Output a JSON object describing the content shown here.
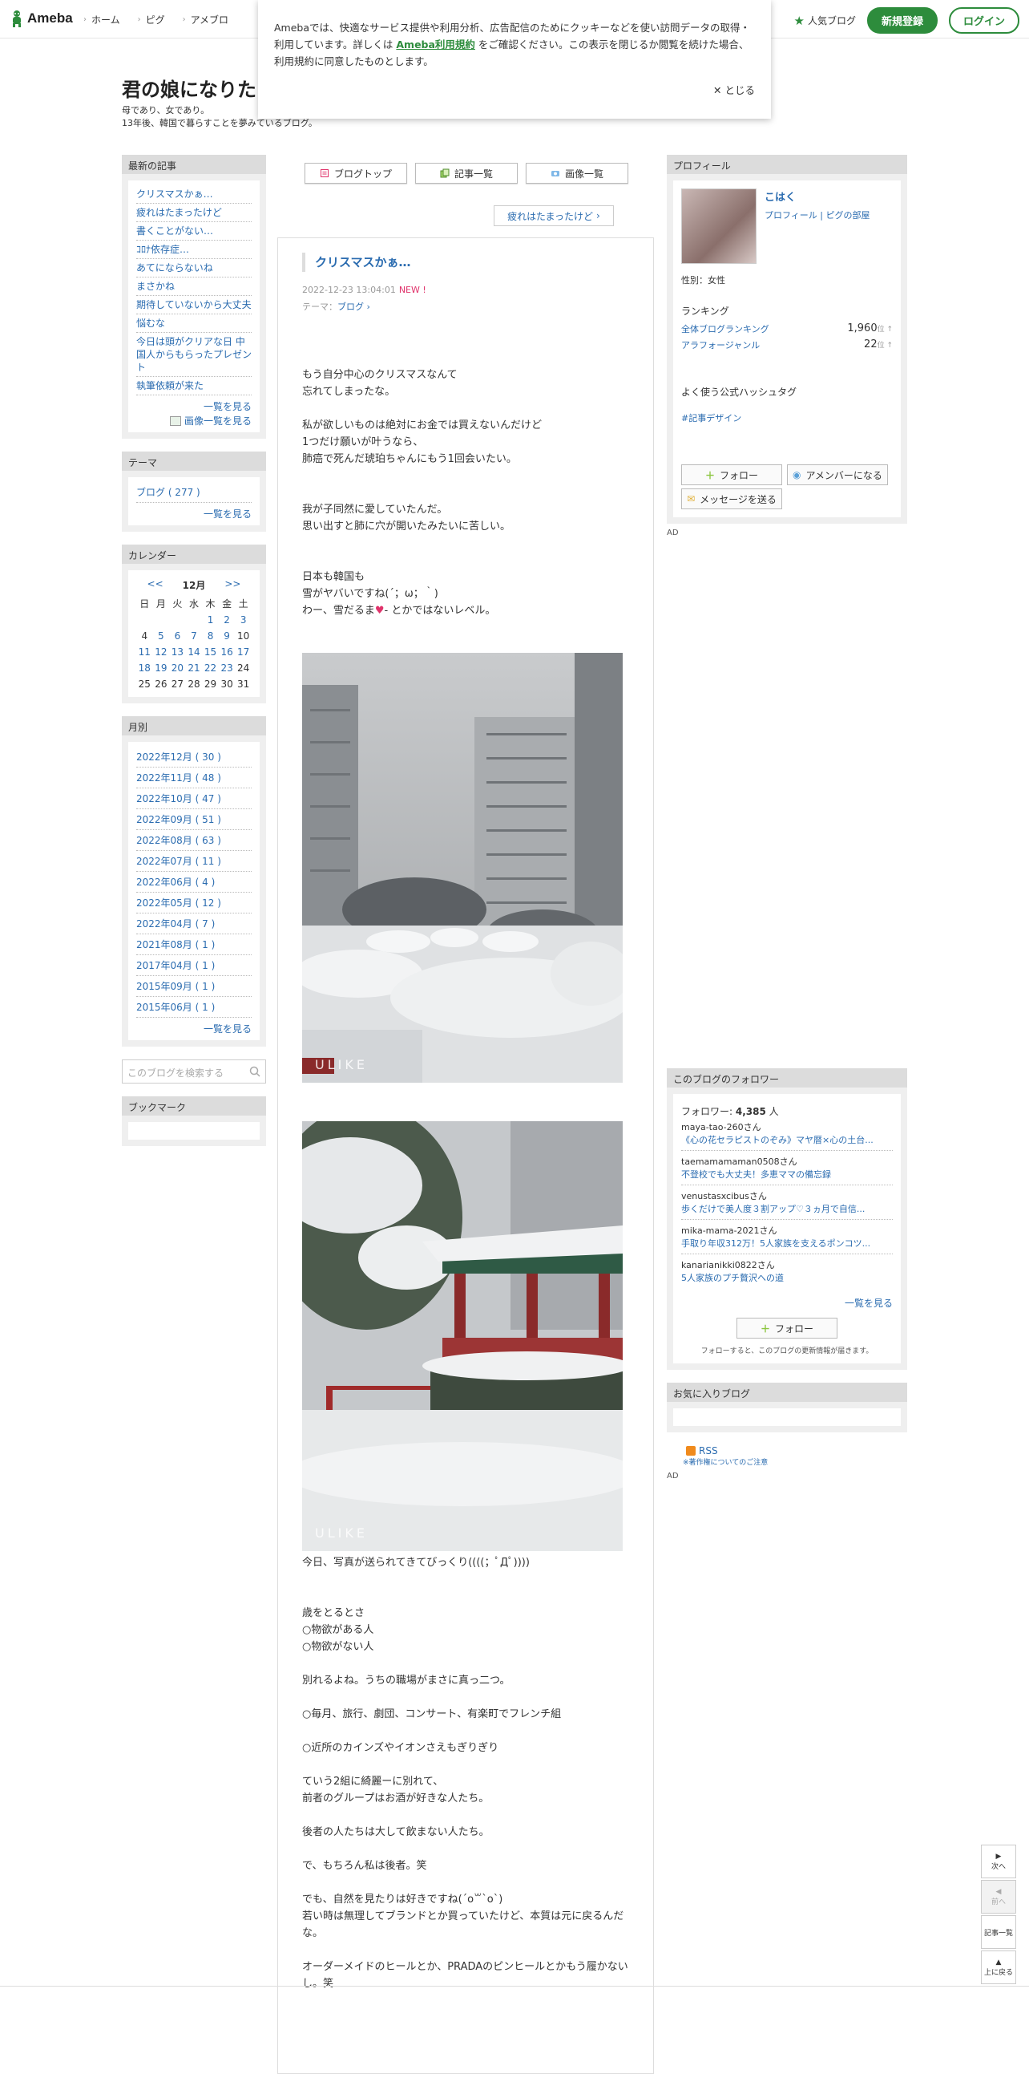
{
  "header": {
    "logo_text": "Ameba",
    "nav": [
      "ホーム",
      "ピグ",
      "アメブロ"
    ],
    "popular_blog": "人気ブログ",
    "register": "新規登録",
    "login": "ログイン",
    "accent_color": "#2d8c3c"
  },
  "cookie": {
    "text_before": "Amebaでは、快適なサービス提供や利用分析、広告配信のためにクッキーなどを使い訪問データの取得・利用しています。詳しくは",
    "link": "Ameba利用規約",
    "text_after": "をご確認ください。この表示を閉じるか閲覧を続けた場合、利用規約に同意したものとします。",
    "close": "とじる"
  },
  "blog": {
    "title": "君の娘になりた",
    "desc1": "母であり、女であり。",
    "desc2": "13年後、韓国で暮らすことを夢みているブログ。"
  },
  "left": {
    "latest_title": "最新の記事",
    "latest": [
      "クリスマスかぁ…",
      "疲れはたまったけど",
      "書くことがない…",
      "ｺﾛﾅ依存症…",
      "あてにならないね",
      "まさかね",
      "期待していないから大丈夫",
      "悩むな",
      "今日は頭がクリアな日 中国人からもらったプレゼント",
      "執筆依頼が来た"
    ],
    "more": "一覧を見る",
    "img_more": "画像一覧を見る",
    "theme_title": "テーマ",
    "themes": [
      "ブログ ( 277 )"
    ],
    "theme_more": "一覧を見る",
    "cal_title": "カレンダー",
    "cal_prev": "<<",
    "cal_month": "12月",
    "cal_next": ">>",
    "cal_days": [
      "日",
      "月",
      "火",
      "水",
      "木",
      "金",
      "土"
    ],
    "cal_rows": [
      [
        "",
        "",
        "",
        "",
        "1",
        "2",
        "3"
      ],
      [
        "4",
        "5",
        "6",
        "7",
        "8",
        "9",
        "10"
      ],
      [
        "11",
        "12",
        "13",
        "14",
        "15",
        "16",
        "17"
      ],
      [
        "18",
        "19",
        "20",
        "21",
        "22",
        "23",
        "24"
      ],
      [
        "25",
        "26",
        "27",
        "28",
        "29",
        "30",
        "31"
      ]
    ],
    "month_title": "月別",
    "months": [
      "2022年12月 ( 30 )",
      "2022年11月 ( 48 )",
      "2022年10月 ( 47 )",
      "2022年09月 ( 51 )",
      "2022年08月 ( 63 )",
      "2022年07月 ( 11 )",
      "2022年06月 ( 4 )",
      "2022年05月 ( 12 )",
      "2022年04月 ( 7 )",
      "2021年08月 ( 1 )",
      "2017年04月 ( 1 )",
      "2015年09月 ( 1 )",
      "2015年06月 ( 1 )"
    ],
    "month_more": "一覧を見る",
    "search_placeholder": "このブログを検索する",
    "bookmark_title": "ブックマーク"
  },
  "main": {
    "tabs": [
      "ブログトップ",
      "記事一覧",
      "画像一覧"
    ],
    "next_article": "疲れはたまったけど",
    "entry_title": "クリスマスかぁ…",
    "date": "2022-12-23 13:04:01",
    "new": "NEW !",
    "theme_label": "テーマ：",
    "theme": "ブログ",
    "p1": [
      "もう自分中心のクリスマスなんて",
      "忘れてしまったな。"
    ],
    "p2": [
      "私が欲しいものは絶対にお金では買えないんだけど",
      "1つだけ願いが叶うなら、",
      "肺癌で死んだ琥珀ちゃんにもう1回会いたい。"
    ],
    "p3": [
      "我が子同然に愛していたんだ。",
      "思い出すと肺に穴が開いたみたいに苦しい。"
    ],
    "p4a": "日本も韓国も",
    "p4b": "雪がヤバいですね(´；ω；｀)",
    "p4c_before": "わー、雪だるま",
    "p4c_after": "- とかではないレベル。",
    "watermark": "ULIKE",
    "caption": "今日、写真が送られてきてびっくり((((；ﾟДﾟ))))",
    "p5": [
      "歳をとるとさ",
      "○物欲がある人",
      "○物欲がない人"
    ],
    "p6": "別れるよね。うちの職場がまさに真っ二つ。",
    "p7": "○毎月、旅行、劇団、コンサート、有楽町でフレンチ組",
    "p8": "○近所のカインズやイオンさえもぎりぎり",
    "p9": [
      "ていう2組に綺麗ーに別れて、",
      "前者のグループはお酒が好きな人たち。"
    ],
    "p10": "後者の人たちは大して飲まない人たち。",
    "p11": "で、もちろん私は後者。笑",
    "p12": [
      "でも、自然を見たりは好きですね(´o꒳ˋo`)",
      "若い時は無理してブランドとか買っていたけど、本質は元に戻るんだな。"
    ],
    "p13": [
      "オーダーメイドのヒールとか、PRADAのピンヒールとかもう履かないし。笑"
    ]
  },
  "right": {
    "profile_title": "プロフィール",
    "name": "こはく",
    "link1": "プロフィール",
    "link2": "ピグの部屋",
    "gender": "性別：女性",
    "ranking": "ランキング",
    "rank1_label": "全体ブログランキング",
    "rank1_value": "1,960",
    "rank2_label": "アラフォージャンル",
    "rank2_value": "22",
    "rank_unit": "位 ↑",
    "hashtag_title": "よく使う公式ハッシュタグ",
    "hashtag": "#記事デザイン",
    "follow": "フォロー",
    "member": "アメンバーになる",
    "message": "メッセージを送る",
    "ad": "AD",
    "followers_title": "このブログのフォロワー",
    "followers_label": "フォロワー: ",
    "followers_count": "4,385",
    "followers_unit": " 人",
    "followers": [
      {
        "user": "maya-tao-260さん",
        "title": "《心の花セラピストのぞみ》マヤ暦×心の土台..."
      },
      {
        "user": "taemamamaman0508さん",
        "title": "不登校でも大丈夫！多恵ママの備忘録"
      },
      {
        "user": "venustasxcibusさん",
        "title": "歩くだけで美人度３割アップ♡３ヵ月で自信..."
      },
      {
        "user": "mika-mama-2021さん",
        "title": "手取り年収312万！5人家族を支えるポンコツ..."
      },
      {
        "user": "kanarianikki0822さん",
        "title": "5人家族のプチ贅沢への道"
      }
    ],
    "followers_more": "一覧を見る",
    "follow_btn": "フォロー",
    "follow_note": "フォローすると、このブログの更新情報が届きます。",
    "fav_title": "お気に入りブログ",
    "rss": "RSS",
    "copyright": "※著作権についてのご注意",
    "ad2": "AD"
  },
  "sidenav": {
    "next": "次へ",
    "prev": "前へ",
    "list": "記事一覧",
    "top": "上に戻る"
  }
}
